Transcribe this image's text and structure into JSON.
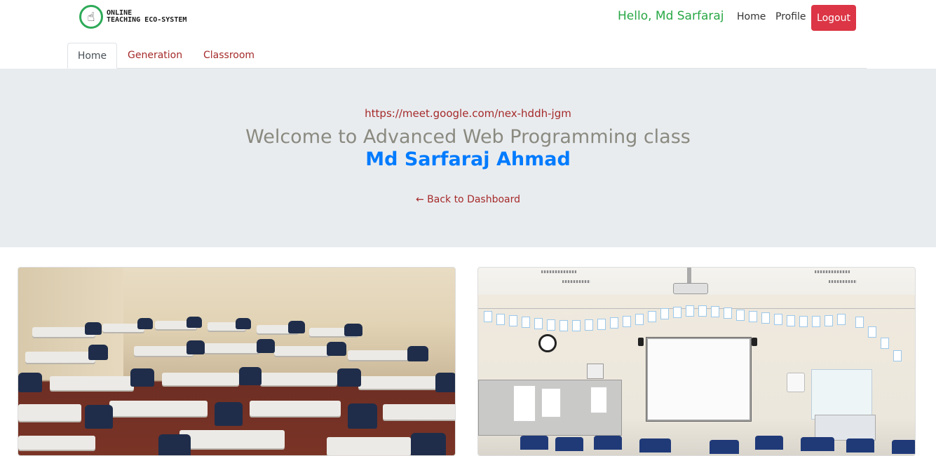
{
  "brand": {
    "line1": "ONLINE",
    "line2": "TEACHING ECO-SYSTEM"
  },
  "header": {
    "greeting": "Hello, Md Sarfaraj",
    "home_label": "Home",
    "profile_label": "Profile",
    "logout_label": "Logout"
  },
  "tabs": [
    {
      "label": "Home",
      "active": true
    },
    {
      "label": "Generation",
      "active": false
    },
    {
      "label": "Classroom",
      "active": false
    }
  ],
  "jumbotron": {
    "meet_link": "https://meet.google.com/nex-hddh-jgm",
    "welcome": "Welcome to Advanced Web Programming class",
    "teacher": "Md Sarfaraj Ahmad",
    "back_link": "← Back to Dashboard"
  },
  "colors": {
    "greeting": "#28a745",
    "logout": "#dc3545",
    "link": "#a52a2a",
    "teacher": "#007bff",
    "jumbotron_bg": "#e9ecef"
  },
  "icons": {
    "logo": "hand-pointer-icon"
  }
}
